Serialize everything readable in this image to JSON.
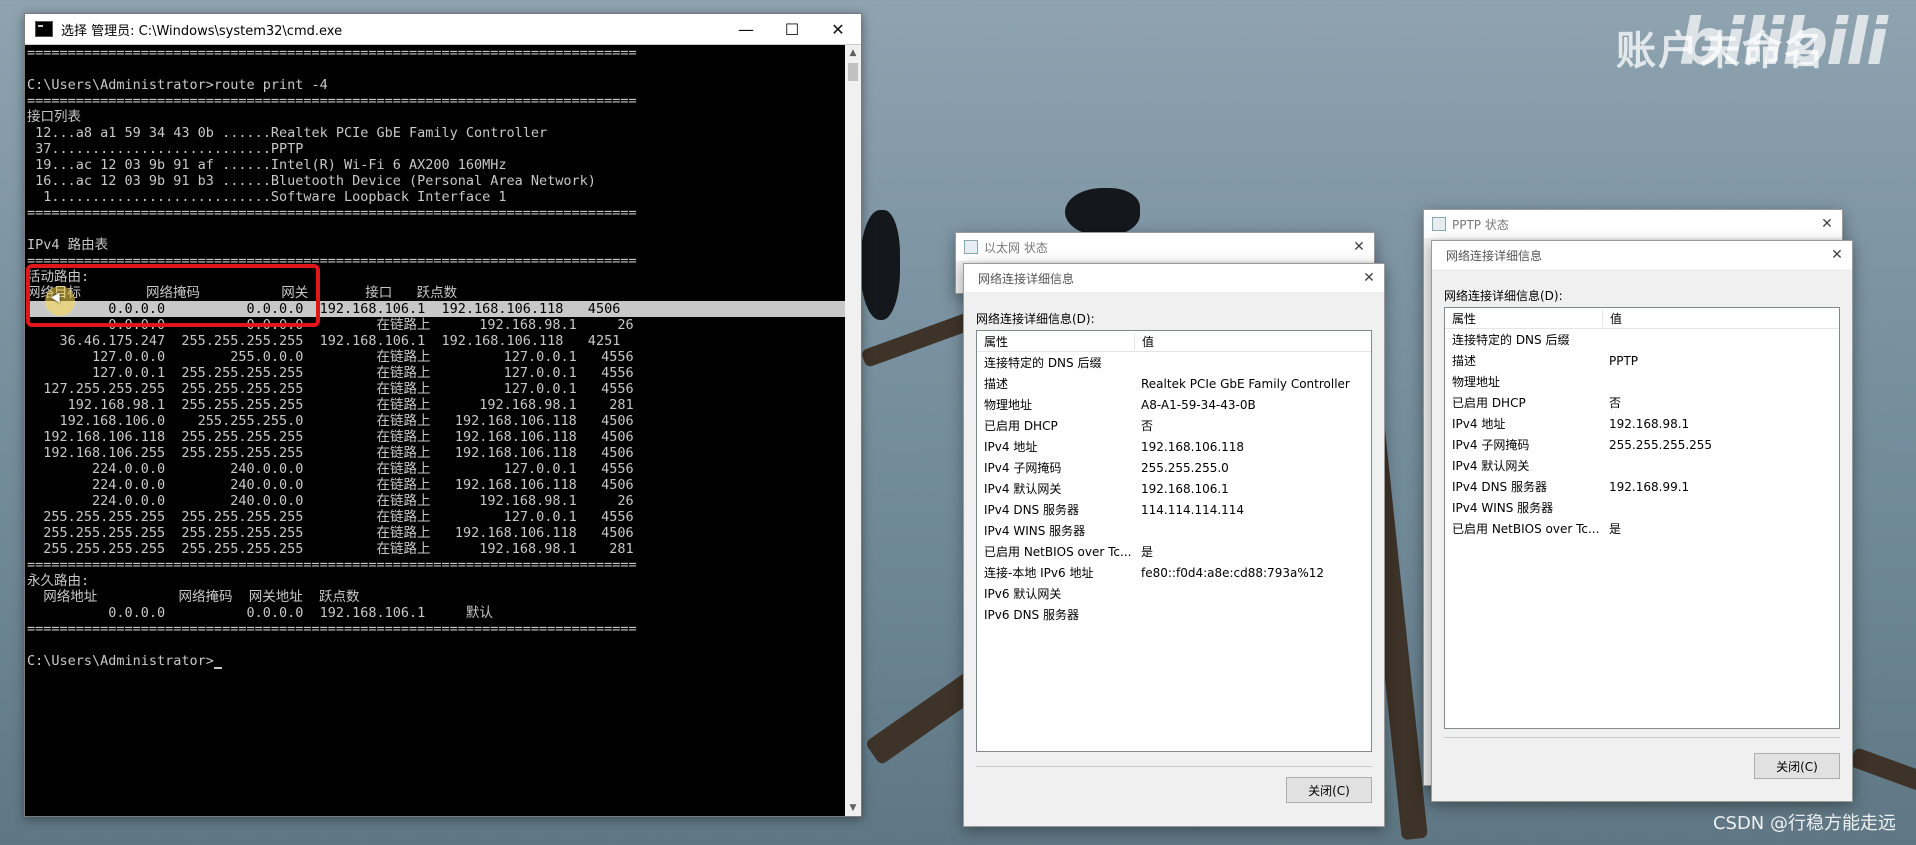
{
  "watermarks": {
    "bilibili_user": "账户未命名",
    "bilibili_logo": "bilibili",
    "csdn": "CSDN @行稳方能走远"
  },
  "cmd": {
    "title": "选择 管理员: C:\\Windows\\system32\\cmd.exe",
    "minimize": "—",
    "maximize": "☐",
    "close": "✕",
    "lines": [
      "===========================================================================",
      "",
      "C:\\Users\\Administrator>route print -4",
      "===========================================================================",
      "接口列表",
      " 12...a8 a1 59 34 43 0b ......Realtek PCIe GbE Family Controller",
      " 37...........................PPTP",
      " 19...ac 12 03 9b 91 af ......Intel(R) Wi-Fi 6 AX200 160MHz",
      " 16...ac 12 03 9b 91 b3 ......Bluetooth Device (Personal Area Network)",
      "  1...........................Software Loopback Interface 1",
      "===========================================================================",
      "",
      "IPv4 路由表",
      "===========================================================================",
      "活动路由:",
      "网络目标        网络掩码          网关       接口   跃点数",
      "          0.0.0.0          0.0.0.0  192.168.106.1  192.168.106.118   4506",
      "          0.0.0.0          0.0.0.0         在链路上      192.168.98.1     26",
      "    36.46.175.247  255.255.255.255  192.168.106.1  192.168.106.118   4251",
      "        127.0.0.0        255.0.0.0         在链路上         127.0.0.1   4556",
      "        127.0.0.1  255.255.255.255         在链路上         127.0.0.1   4556",
      "  127.255.255.255  255.255.255.255         在链路上         127.0.0.1   4556",
      "     192.168.98.1  255.255.255.255         在链路上      192.168.98.1    281",
      "    192.168.106.0    255.255.255.0         在链路上   192.168.106.118   4506",
      "  192.168.106.118  255.255.255.255         在链路上   192.168.106.118   4506",
      "  192.168.106.255  255.255.255.255         在链路上   192.168.106.118   4506",
      "        224.0.0.0        240.0.0.0         在链路上         127.0.0.1   4556",
      "        224.0.0.0        240.0.0.0         在链路上   192.168.106.118   4506",
      "        224.0.0.0        240.0.0.0         在链路上      192.168.98.1     26",
      "  255.255.255.255  255.255.255.255         在链路上         127.0.0.1   4556",
      "  255.255.255.255  255.255.255.255         在链路上   192.168.106.118   4506",
      "  255.255.255.255  255.255.255.255         在链路上      192.168.98.1    281",
      "===========================================================================",
      "永久路由:",
      "  网络地址          网络掩码  网关地址  跃点数",
      "          0.0.0.0          0.0.0.0  192.168.106.1     默认",
      "===========================================================================",
      "",
      "C:\\Users\\Administrator>"
    ],
    "highlighted_line_index": 16
  },
  "ethernet": {
    "outer_title": "以太网 状态",
    "detail_title": "网络连接详细信息",
    "detail_label": "网络连接详细信息(D):",
    "col_property": "属性",
    "col_value": "值",
    "rows": [
      [
        "连接特定的 DNS 后缀",
        ""
      ],
      [
        "描述",
        "Realtek PCIe GbE Family Controller"
      ],
      [
        "物理地址",
        "A8-A1-59-34-43-0B"
      ],
      [
        "已启用 DHCP",
        "否"
      ],
      [
        "IPv4 地址",
        "192.168.106.118"
      ],
      [
        "IPv4 子网掩码",
        "255.255.255.0"
      ],
      [
        "IPv4 默认网关",
        "192.168.106.1"
      ],
      [
        "IPv4 DNS 服务器",
        "114.114.114.114"
      ],
      [
        "IPv4 WINS 服务器",
        ""
      ],
      [
        "已启用 NetBIOS over Tc...",
        "是"
      ],
      [
        "连接-本地 IPv6 地址",
        "fe80::f0d4:a8e:cd88:793a%12"
      ],
      [
        "IPv6 默认网关",
        ""
      ],
      [
        "IPv6 DNS 服务器",
        ""
      ]
    ],
    "close_button": "关闭(C)"
  },
  "pptp": {
    "outer_title": "PPTP 状态",
    "detail_title": "网络连接详细信息",
    "detail_label": "网络连接详细信息(D):",
    "col_property": "属性",
    "col_value": "值",
    "rows": [
      [
        "连接特定的 DNS 后缀",
        ""
      ],
      [
        "描述",
        "PPTP"
      ],
      [
        "物理地址",
        ""
      ],
      [
        "已启用 DHCP",
        "否"
      ],
      [
        "IPv4 地址",
        "192.168.98.1"
      ],
      [
        "IPv4 子网掩码",
        "255.255.255.255"
      ],
      [
        "IPv4 默认网关",
        ""
      ],
      [
        "IPv4 DNS 服务器",
        "192.168.99.1"
      ],
      [
        "IPv4 WINS 服务器",
        ""
      ],
      [
        "已启用 NetBIOS over Tc...",
        "是"
      ]
    ],
    "close_button": "关闭(C)"
  }
}
